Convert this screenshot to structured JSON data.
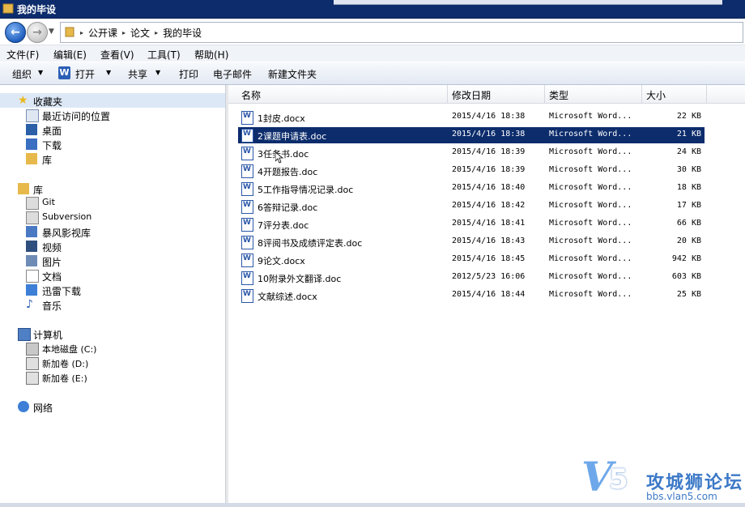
{
  "window": {
    "title": "我的毕设"
  },
  "address": {
    "crumbs": [
      "公开课",
      "论文",
      "我的毕设"
    ]
  },
  "menu": [
    {
      "label": "文件(F)"
    },
    {
      "label": "编辑(E)"
    },
    {
      "label": "查看(V)"
    },
    {
      "label": "工具(T)"
    },
    {
      "label": "帮助(H)"
    }
  ],
  "toolbar": {
    "organize": "组织",
    "open": "打开",
    "share": "共享",
    "print": "打印",
    "email": "电子邮件",
    "new_folder": "新建文件夹"
  },
  "nav": {
    "favorites": {
      "label": "收藏夹",
      "items": [
        "最近访问的位置",
        "桌面",
        "下载",
        "库"
      ]
    },
    "libraries": {
      "label": "库",
      "items": [
        "Git",
        "Subversion",
        "暴风影视库",
        "视频",
        "图片",
        "文档",
        "迅雷下载",
        "音乐"
      ]
    },
    "computer": {
      "label": "计算机",
      "items": [
        "本地磁盘 (C:)",
        "新加卷 (D:)",
        "新加卷 (E:)"
      ]
    },
    "network": {
      "label": "网络"
    }
  },
  "columns": {
    "name": "名称",
    "date": "修改日期",
    "type": "类型",
    "size": "大小"
  },
  "files": [
    {
      "name": "1封皮.docx",
      "date": "2015/4/16 18:38",
      "type": "Microsoft Word...",
      "size": "22 KB"
    },
    {
      "name": "2课题申请表.doc",
      "date": "2015/4/16 18:38",
      "type": "Microsoft Word...",
      "size": "21 KB"
    },
    {
      "name": "3任务书.doc",
      "date": "2015/4/16 18:39",
      "type": "Microsoft Word...",
      "size": "24 KB"
    },
    {
      "name": "4开题报告.doc",
      "date": "2015/4/16 18:39",
      "type": "Microsoft Word...",
      "size": "30 KB"
    },
    {
      "name": "5工作指导情况记录.doc",
      "date": "2015/4/16 18:40",
      "type": "Microsoft Word...",
      "size": "18 KB"
    },
    {
      "name": "6答辩记录.doc",
      "date": "2015/4/16 18:42",
      "type": "Microsoft Word...",
      "size": "17 KB"
    },
    {
      "name": "7评分表.doc",
      "date": "2015/4/16 18:41",
      "type": "Microsoft Word...",
      "size": "66 KB"
    },
    {
      "name": "8评阅书及成绩评定表.doc",
      "date": "2015/4/16 18:43",
      "type": "Microsoft Word...",
      "size": "20 KB"
    },
    {
      "name": "9论文.docx",
      "date": "2015/4/16 18:45",
      "type": "Microsoft Word...",
      "size": "942 KB"
    },
    {
      "name": "10附录外文翻译.doc",
      "date": "2012/5/23 16:06",
      "type": "Microsoft Word...",
      "size": "603 KB"
    },
    {
      "name": "文献综述.docx",
      "date": "2015/4/16 18:44",
      "type": "Microsoft Word...",
      "size": "25 KB"
    }
  ],
  "selected_file_index": 1,
  "watermark": {
    "v": "V",
    "five": "5",
    "cn": "攻城狮论坛",
    "url": "bbs.vlan5.com"
  },
  "colors": {
    "titlebar": "#0c2c6c",
    "selection": "#0c2c6c",
    "watermark": "#3c79c7"
  }
}
